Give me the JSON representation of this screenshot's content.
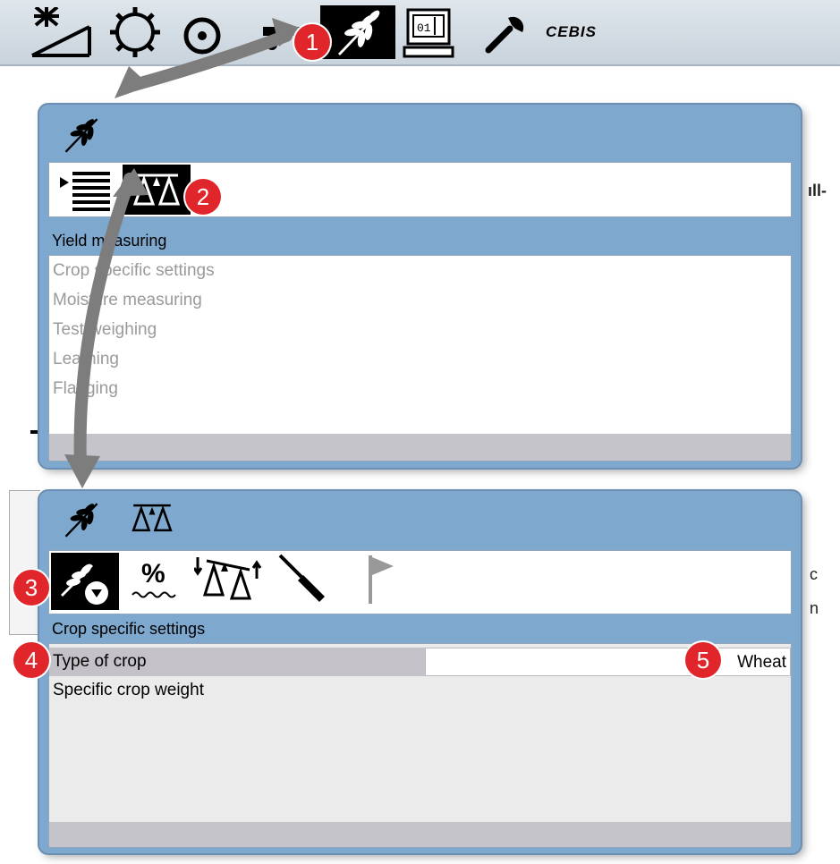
{
  "topbar": {
    "icons": [
      "solar-sun-icon",
      "gear-icon",
      "speedometer-icon",
      "tractor-icon",
      "grain-ear-icon",
      "computer-terminal-icon",
      "wrench-icon"
    ],
    "cebis_label": "CEBIS"
  },
  "panel1": {
    "header_icon": "grain-ear-icon",
    "tabs": [
      "menu-list-icon",
      "scale-icon"
    ],
    "section_title": "Yield measuring",
    "items": [
      "Crop specific settings",
      "Moisture measuring",
      "Test-weighing",
      "Learning",
      "Flagging"
    ]
  },
  "panel2": {
    "header_icons": [
      "grain-ear-icon",
      "scale-icon"
    ],
    "tabs": [
      "crop-settings-icon",
      "moisture-percent-icon",
      "calibration-weighing-icon",
      "screwdriver-icon",
      "flag-icon"
    ],
    "section_title": "Crop specific settings",
    "rows": [
      {
        "label": "Type of crop",
        "value": "Wheat"
      },
      {
        "label": "Specific crop weight",
        "value": ""
      }
    ]
  },
  "badges": [
    "1",
    "2",
    "3",
    "4",
    "5"
  ],
  "background_fragments": [
    "ıll-",
    "c",
    "n"
  ],
  "colors": {
    "panel_blue": "#7ea8cd",
    "badge_red": "#e0262a",
    "arrow_gray": "#7d7d7d",
    "footer_gray": "#c4c4ca"
  }
}
